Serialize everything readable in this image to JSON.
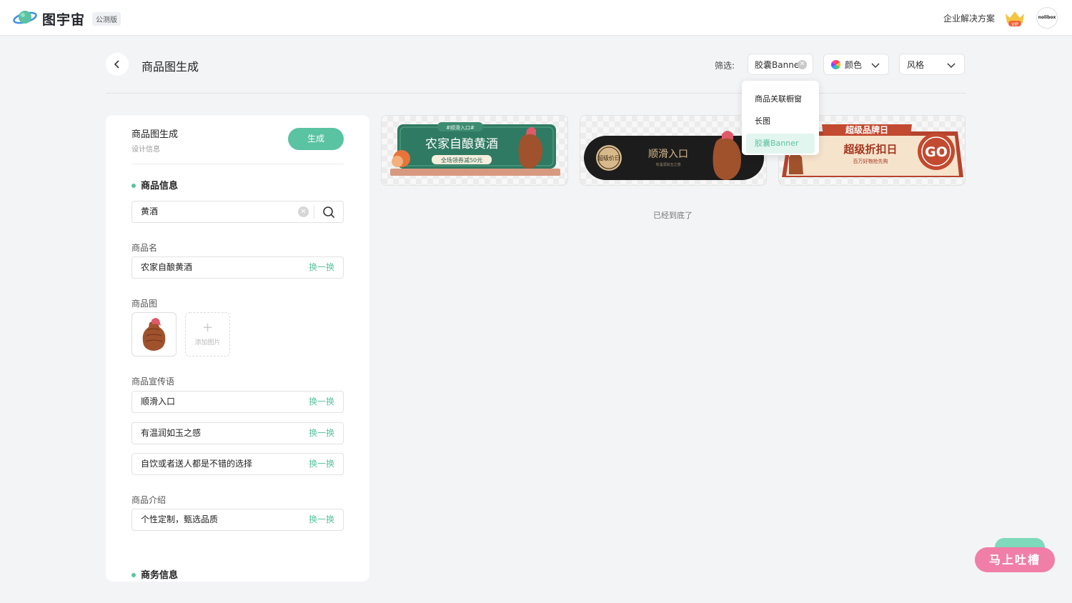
{
  "header": {
    "brand": "图宇宙",
    "badge": "公测版",
    "enterprise_link": "企业解决方案",
    "vip_label": "VIP",
    "avatar_text": "nolibox"
  },
  "page": {
    "title": "商品图生成",
    "filter_label": "筛选:",
    "filters": {
      "banner_chip": "胶囊Banner",
      "color": "颜色",
      "style": "风格"
    },
    "dropdown_options": [
      "商品关联橱窗",
      "长图",
      "胶囊Banner"
    ],
    "dropdown_selected": "胶囊Banner",
    "end_of_list": "已经到底了"
  },
  "panel": {
    "title": "商品图生成",
    "subtitle": "设计信息",
    "generate_button": "生成",
    "product_section": "商品信息",
    "search_value": "黄酒",
    "name_label": "商品名",
    "name_value": "农家自酿黄酒",
    "swap_label": "换一换",
    "image_label": "商品图",
    "add_image": "添加图片",
    "slogan_label": "商品宣传语",
    "slogans": [
      "顺滑入口",
      "有温润如玉之感",
      "自饮或者送人都是不错的选择"
    ],
    "intro_label": "商品介绍",
    "intro_value": "个性定制，甄选品质",
    "business_section": "商务信息"
  },
  "cards": [
    {
      "tag": "#顺滑入口#",
      "title": "农家自酿黄酒",
      "ribbon": "全场领券减50元"
    },
    {
      "badge": "超级价日",
      "title": "顺滑入口",
      "sub": "有温润如玉之感"
    },
    {
      "title": "超级品牌日",
      "headline": "超级折扣日",
      "sub": "百万好物抢先购",
      "go": "GO"
    }
  ],
  "feedback_button": "马上吐槽",
  "colors": {
    "accent": "#5ac3a1",
    "feedback": "#f07ea6"
  }
}
